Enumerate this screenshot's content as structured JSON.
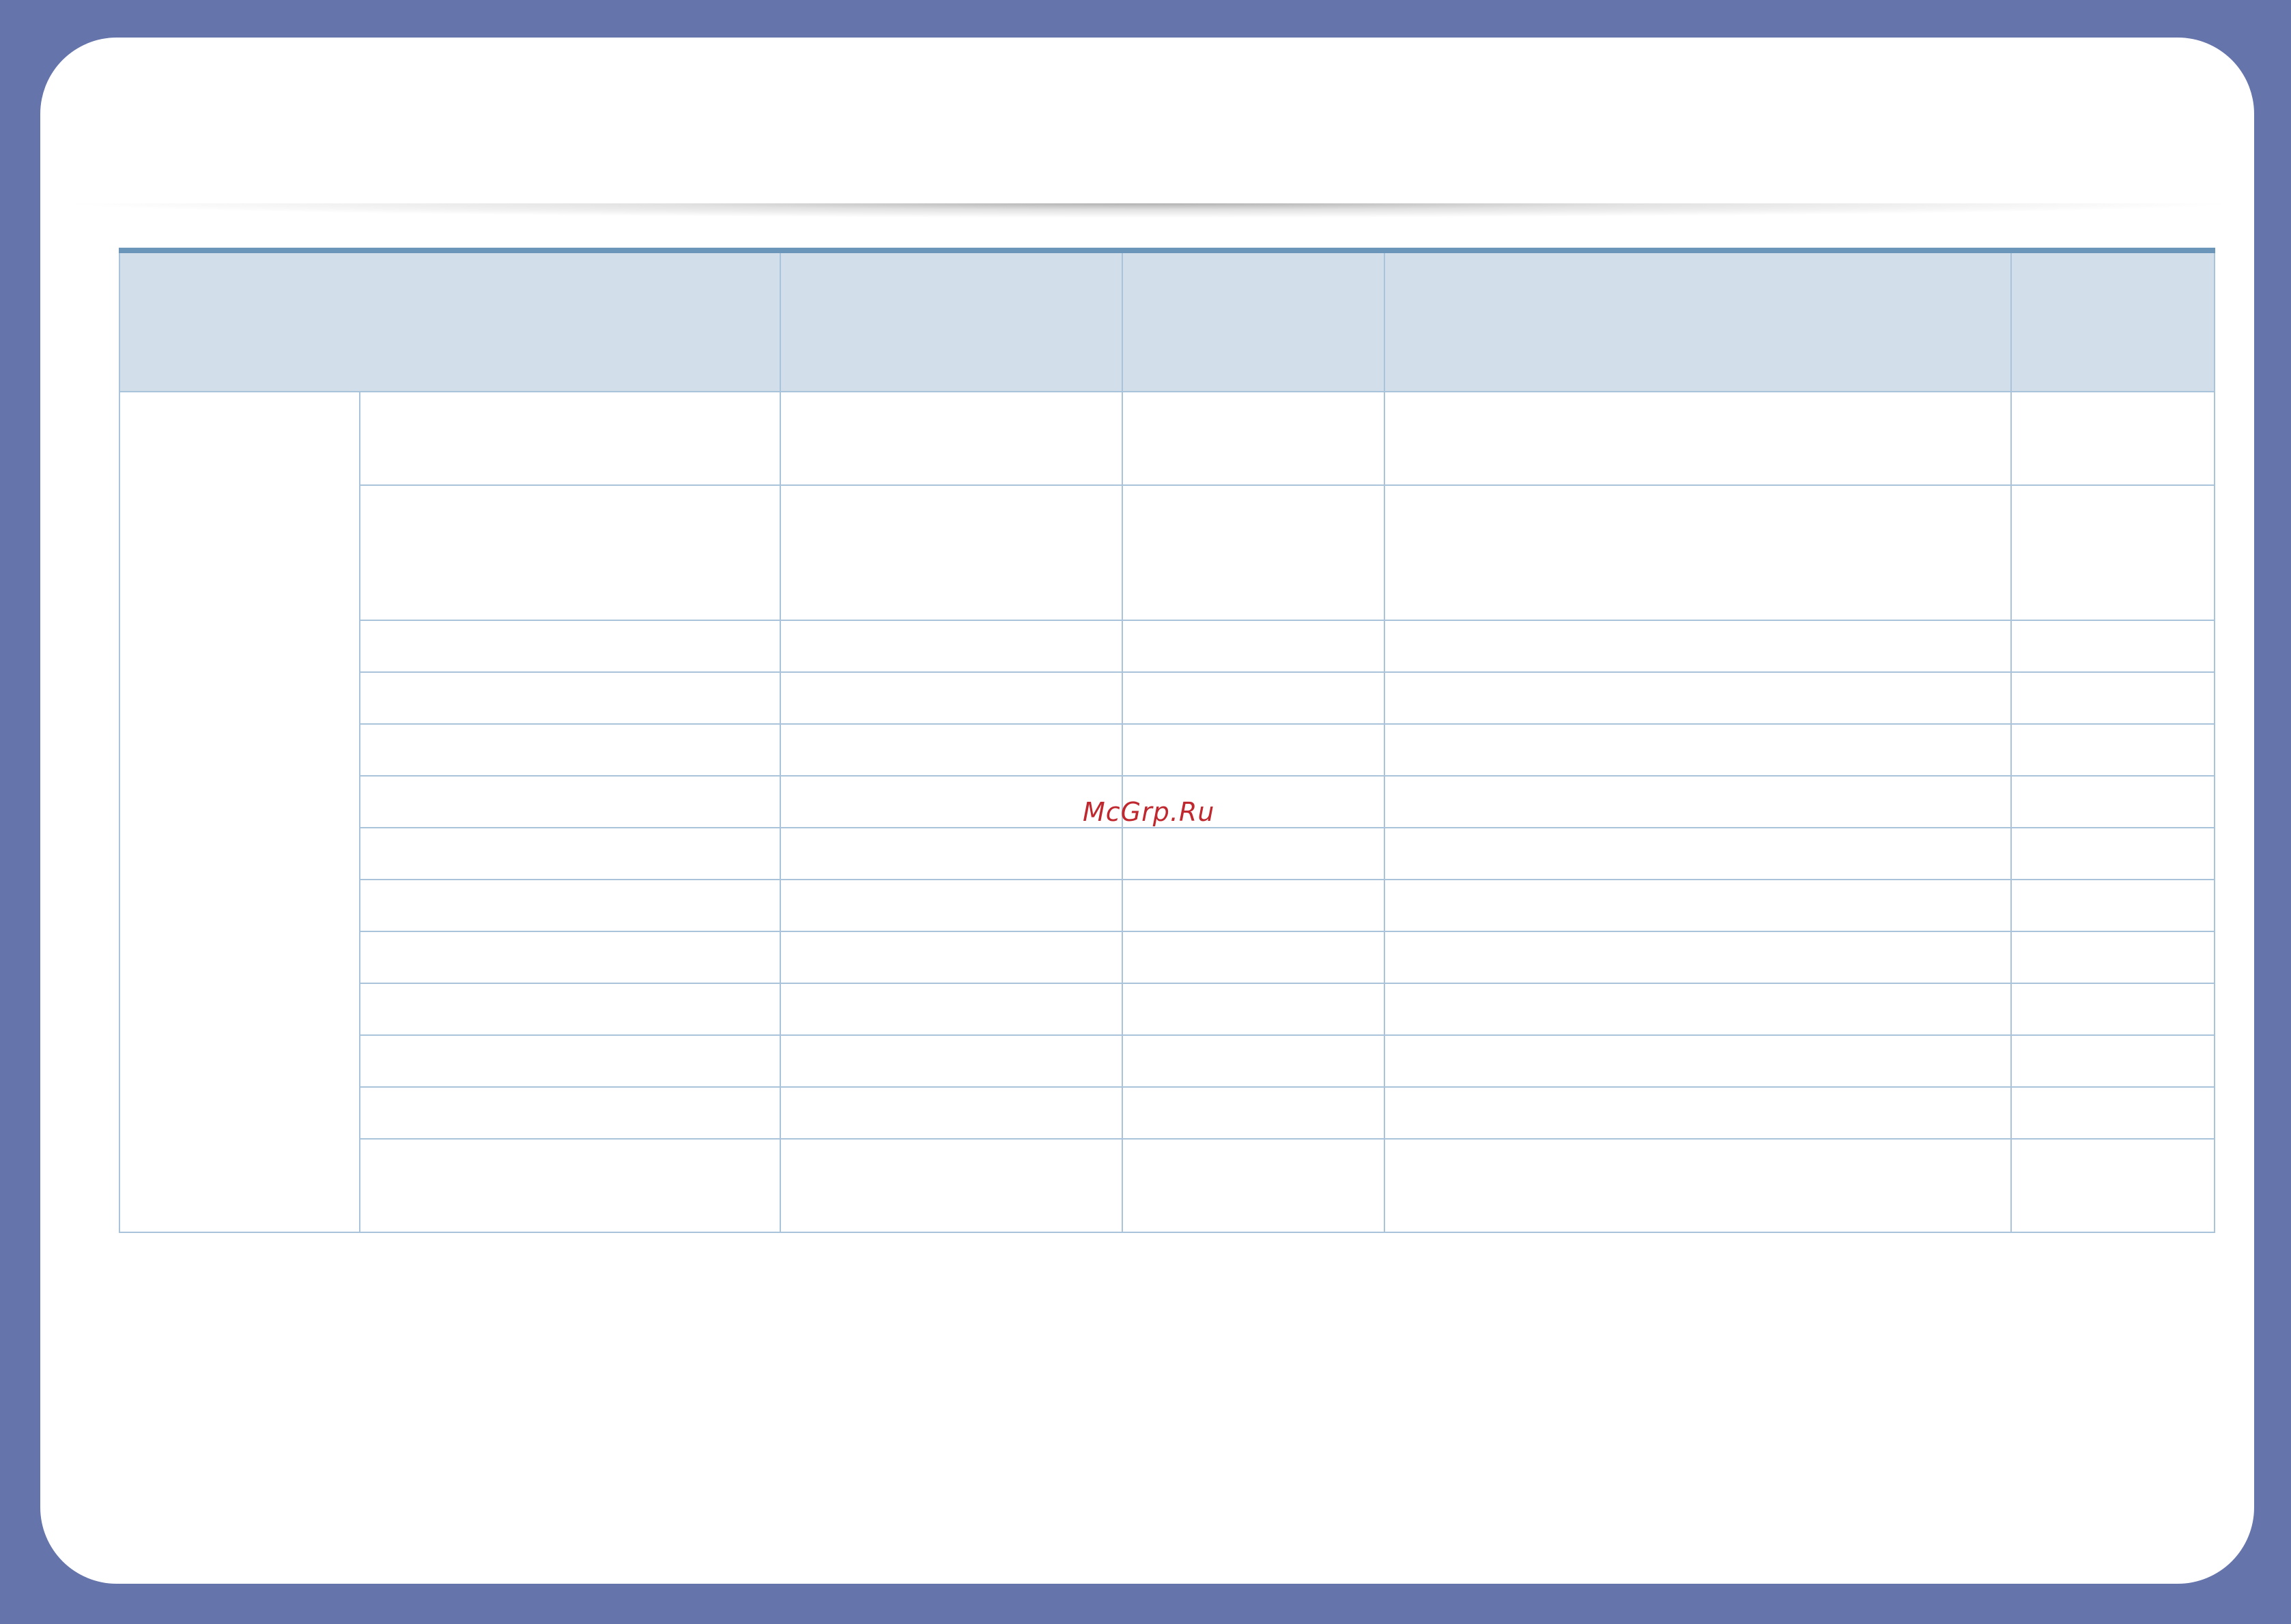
{
  "watermark": {
    "text": "McGrp.Ru"
  },
  "table": {
    "headers": [
      "",
      "",
      "",
      "",
      ""
    ],
    "group_label": "",
    "rows": [
      {
        "size": "tall",
        "cells": [
          "",
          "",
          "",
          "",
          ""
        ]
      },
      {
        "size": "xtall",
        "cells": [
          "",
          "",
          "",
          "",
          ""
        ]
      },
      {
        "size": "std",
        "cells": [
          "",
          "",
          "",
          "",
          ""
        ]
      },
      {
        "size": "std",
        "cells": [
          "",
          "",
          "",
          "",
          ""
        ]
      },
      {
        "size": "std",
        "cells": [
          "",
          "",
          "",
          "",
          ""
        ]
      },
      {
        "size": "std",
        "cells": [
          "",
          "",
          "",
          "",
          ""
        ]
      },
      {
        "size": "std",
        "cells": [
          "",
          "",
          "",
          "",
          ""
        ]
      },
      {
        "size": "std",
        "cells": [
          "",
          "",
          "",
          "",
          ""
        ]
      },
      {
        "size": "std",
        "cells": [
          "",
          "",
          "",
          "",
          ""
        ]
      },
      {
        "size": "std",
        "cells": [
          "",
          "",
          "",
          "",
          ""
        ]
      },
      {
        "size": "std",
        "cells": [
          "",
          "",
          "",
          "",
          ""
        ]
      },
      {
        "size": "std",
        "cells": [
          "",
          "",
          "",
          "",
          ""
        ]
      },
      {
        "size": "tall",
        "cells": [
          "",
          "",
          "",
          "",
          ""
        ]
      }
    ]
  }
}
